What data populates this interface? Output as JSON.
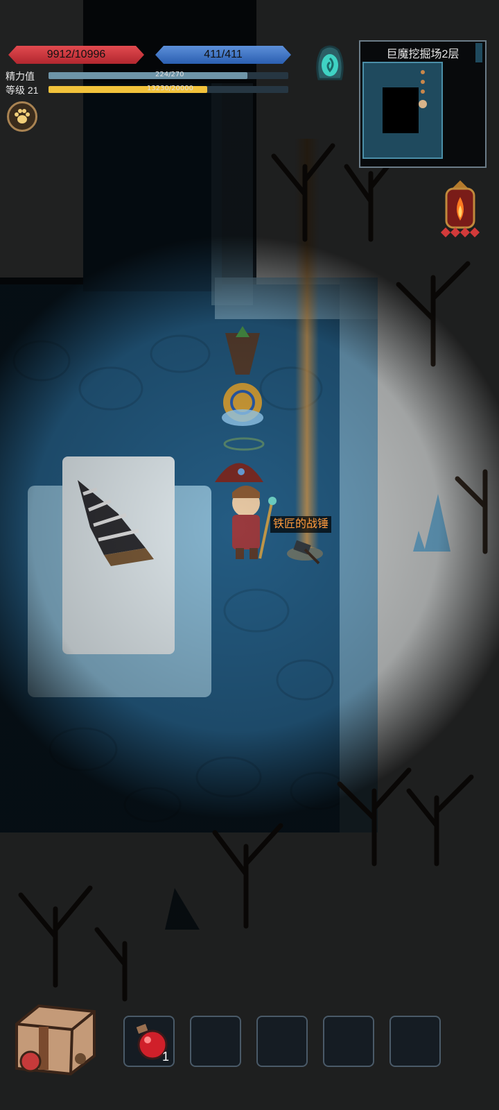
{
  "hud": {
    "hp": {
      "label": "9912/10996",
      "fraction": 0.9014
    },
    "mp": {
      "label": "411/411",
      "fraction": 1.0
    },
    "stamina": {
      "name": "精力值",
      "value_text": "224/270",
      "fraction": 0.8296
    },
    "level": {
      "name": "等级 21",
      "value_text": "13230/20000",
      "fraction": 0.6615
    },
    "colors": {
      "hp": "#d03a40",
      "mp": "#3f74c6",
      "stamina": "#6e95a8",
      "xp": "#f2c23b"
    }
  },
  "minimap": {
    "title": "巨魔挖掘场2层"
  },
  "world": {
    "dropped_item_label": "铁匠的战锤",
    "beam_color": "#f0a040"
  },
  "icons": {
    "paw": "paw-icon",
    "portal": "portal-icon",
    "lantern": "lantern-icon",
    "backpack": "backpack-icon",
    "potion": "health-potion-icon",
    "hammer": "warhammer-icon",
    "drill": "drill-icon"
  },
  "inventory": {
    "slots": [
      {
        "item": "health-potion-icon",
        "count": "1"
      },
      {
        "item": "",
        "count": ""
      },
      {
        "item": "",
        "count": ""
      },
      {
        "item": "",
        "count": ""
      },
      {
        "item": "",
        "count": ""
      }
    ]
  }
}
